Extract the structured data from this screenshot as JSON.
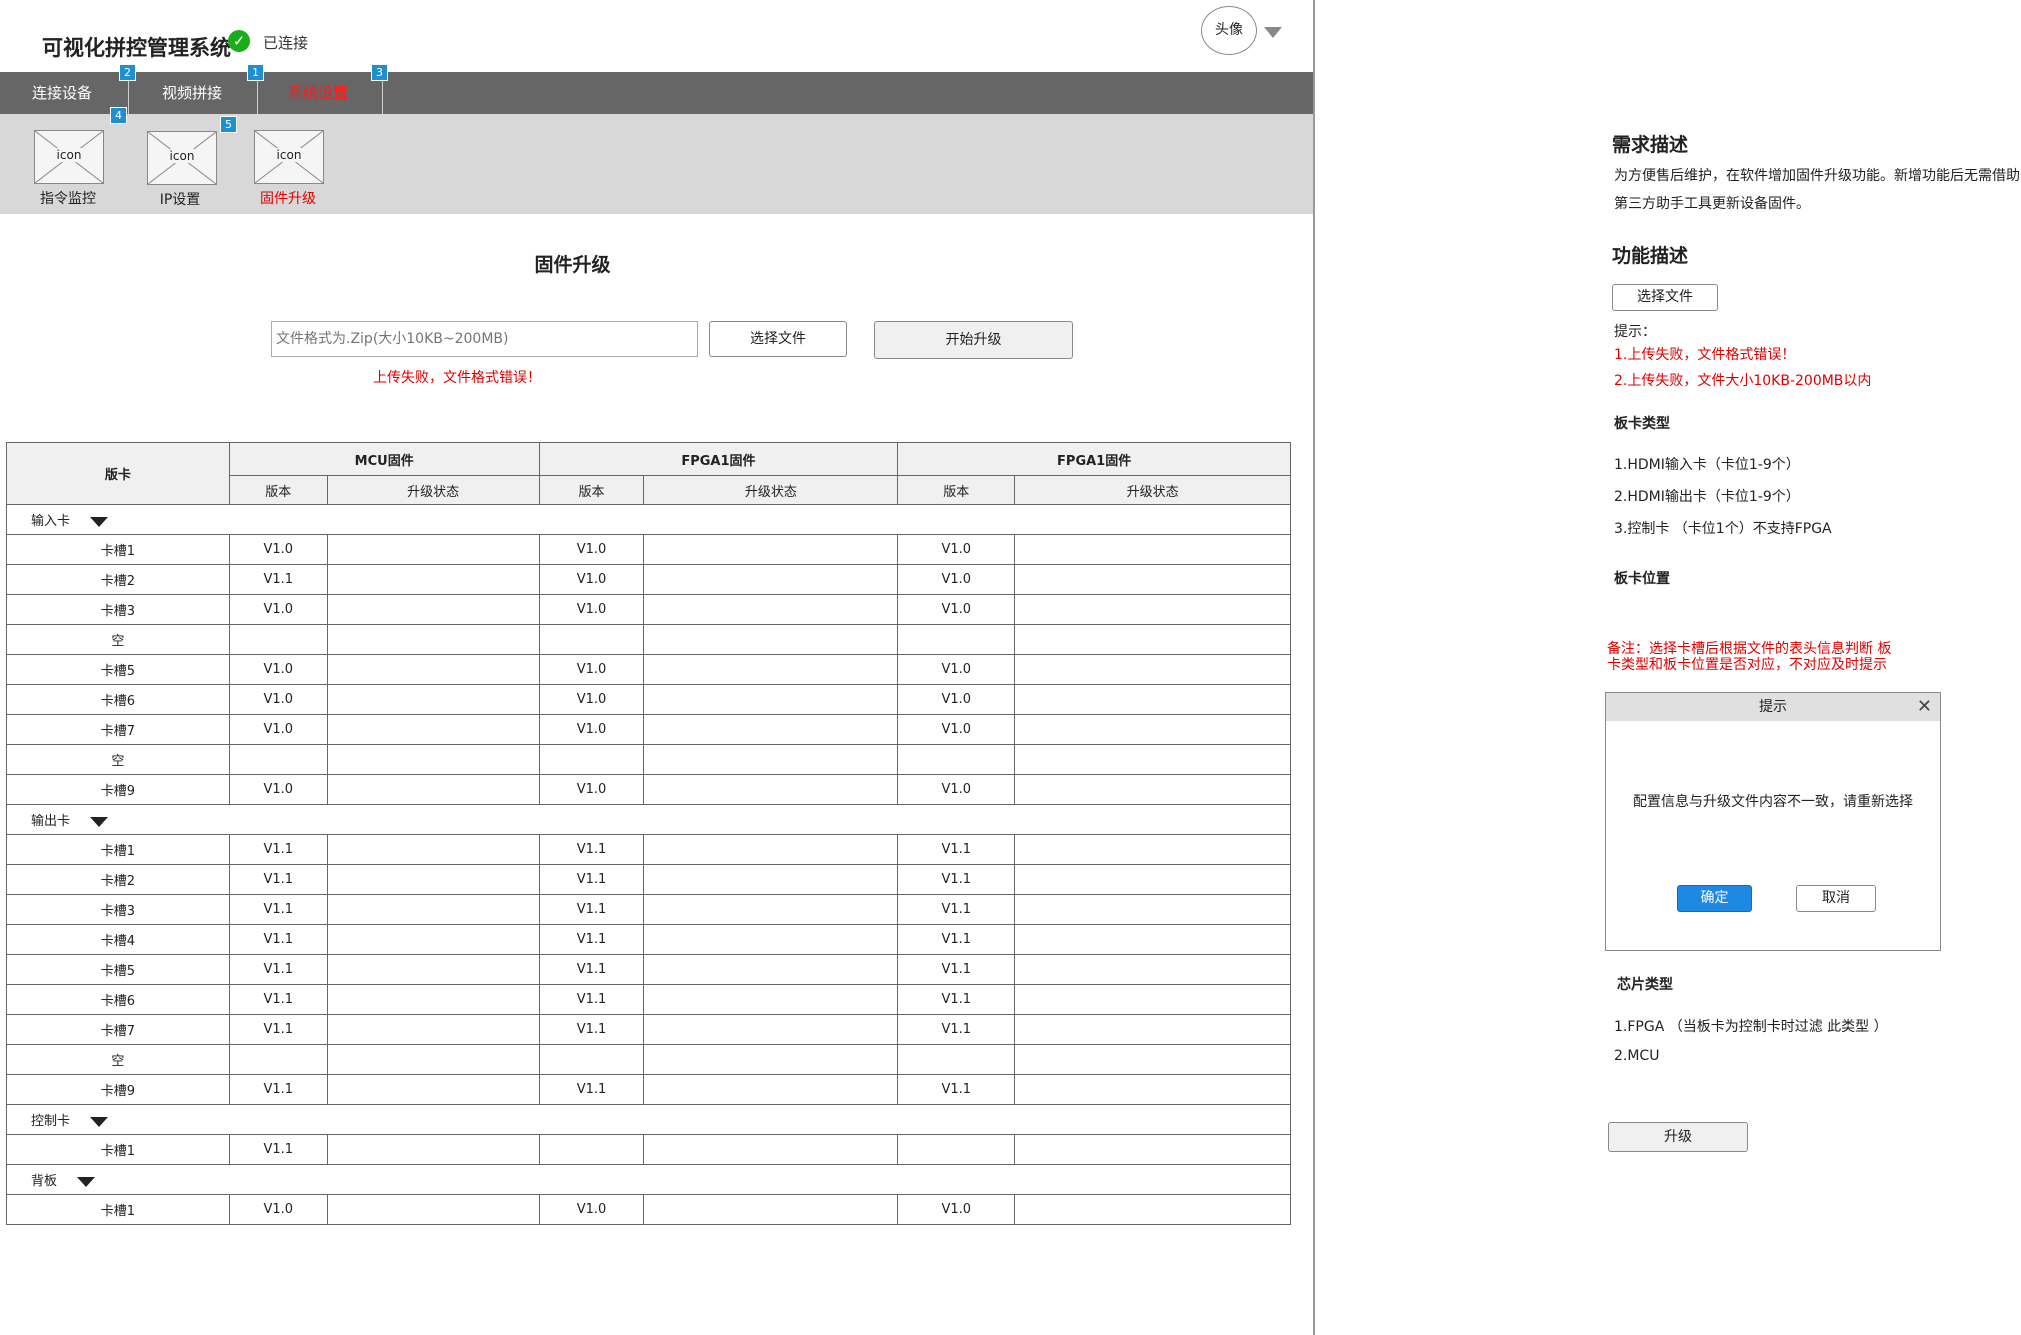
{
  "header": {
    "app_title": "可视化拼控管理系统",
    "connection_status": "已连接",
    "avatar_label": "头像",
    "status_color": "#1aad19"
  },
  "nav": {
    "tabs": [
      {
        "label": "连接设备",
        "badge": "2"
      },
      {
        "label": "视频拼接",
        "badge": "1"
      },
      {
        "label": "系统设置",
        "badge": "3",
        "active": true
      }
    ],
    "active_color": "#ff1a1a"
  },
  "subnav": {
    "items": [
      {
        "label": "指令监控",
        "icon_text": "icon",
        "badge": "4"
      },
      {
        "label": "IP设置",
        "icon_text": "icon",
        "badge": "5"
      },
      {
        "label": "固件升级",
        "icon_text": "icon",
        "active": true
      }
    ]
  },
  "main": {
    "title": "固件升级",
    "file_placeholder": "文件格式为.Zip(大小10KB~200MB)",
    "choose_file_label": "选择文件",
    "start_upgrade_label": "开始升级",
    "error_text": "上传失败，文件格式错误！"
  },
  "table": {
    "header_board": "版卡",
    "groups_header": [
      "MCU固件",
      "FPGA1固件",
      "FPGA1固件"
    ],
    "sub_version": "版本",
    "sub_status": "升级状态",
    "sections": [
      {
        "name": "输入卡",
        "rows": [
          {
            "slot": "卡槽1",
            "mcu": "V1.0",
            "fpga1": "V1.0",
            "fpga2": "V1.0"
          },
          {
            "slot": "卡槽2",
            "mcu": "V1.1",
            "fpga1": "V1.0",
            "fpga2": "V1.0"
          },
          {
            "slot": "卡槽3",
            "mcu": "V1.0",
            "fpga1": "V1.0",
            "fpga2": "V1.0"
          },
          {
            "slot": "空",
            "mcu": "",
            "fpga1": "",
            "fpga2": ""
          },
          {
            "slot": "卡槽5",
            "mcu": "V1.0",
            "fpga1": "V1.0",
            "fpga2": "V1.0"
          },
          {
            "slot": "卡槽6",
            "mcu": "V1.0",
            "fpga1": "V1.0",
            "fpga2": "V1.0"
          },
          {
            "slot": "卡槽7",
            "mcu": "V1.0",
            "fpga1": "V1.0",
            "fpga2": "V1.0"
          },
          {
            "slot": "空",
            "mcu": "",
            "fpga1": "",
            "fpga2": ""
          },
          {
            "slot": "卡槽9",
            "mcu": "V1.0",
            "fpga1": "V1.0",
            "fpga2": "V1.0"
          }
        ]
      },
      {
        "name": "输出卡",
        "rows": [
          {
            "slot": "卡槽1",
            "mcu": "V1.1",
            "fpga1": "V1.1",
            "fpga2": "V1.1"
          },
          {
            "slot": "卡槽2",
            "mcu": "V1.1",
            "fpga1": "V1.1",
            "fpga2": "V1.1"
          },
          {
            "slot": "卡槽3",
            "mcu": "V1.1",
            "fpga1": "V1.1",
            "fpga2": "V1.1"
          },
          {
            "slot": "卡槽4",
            "mcu": "V1.1",
            "fpga1": "V1.1",
            "fpga2": "V1.1"
          },
          {
            "slot": "卡槽5",
            "mcu": "V1.1",
            "fpga1": "V1.1",
            "fpga2": "V1.1"
          },
          {
            "slot": "卡槽6",
            "mcu": "V1.1",
            "fpga1": "V1.1",
            "fpga2": "V1.1"
          },
          {
            "slot": "卡槽7",
            "mcu": "V1.1",
            "fpga1": "V1.1",
            "fpga2": "V1.1"
          },
          {
            "slot": "空",
            "mcu": "",
            "fpga1": "",
            "fpga2": ""
          },
          {
            "slot": "卡槽9",
            "mcu": "V1.1",
            "fpga1": "V1.1",
            "fpga2": "V1.1"
          }
        ]
      },
      {
        "name": "控制卡",
        "rows": [
          {
            "slot": "卡槽1",
            "mcu": "V1.1",
            "fpga1": "",
            "fpga2": ""
          }
        ]
      },
      {
        "name": "背板",
        "rows": [
          {
            "slot": "卡槽1",
            "mcu": "V1.0",
            "fpga1": "V1.0",
            "fpga2": "V1.0"
          }
        ]
      }
    ]
  },
  "notes": {
    "req_title": "需求描述",
    "req_line1": "为方便售后维护，在软件增加固件升级功能。新增功能后无需借助",
    "req_line2": "第三方助手工具更新设备固件。",
    "func_title": "功能描述",
    "choose_file_label": "选择文件",
    "hint_label": "提示：",
    "hint1": "1.上传失败，文件格式错误！",
    "hint2": "2.上传失败，文件大小10KB-200MB以内",
    "board_type_title": "板卡类型",
    "board_types": [
      "1.HDMI输入卡（卡位1-9个）",
      "2.HDMI输出卡（卡位1-9个）",
      "3.控制卡 （卡位1个）不支持FPGA"
    ],
    "board_pos_title": "板卡位置",
    "remark_line1": "备注：选择卡槽后根据文件的表头信息判断 板",
    "remark_line2": "卡类型和板卡位置是否对应，不对应及时提示",
    "dialog": {
      "title": "提示",
      "close": "✕",
      "message": "配置信息与升级文件内容不一致，请重新选择",
      "ok_label": "确定",
      "cancel_label": "取消",
      "ok_color": "#1e88e5"
    },
    "chip_type_title": "芯片类型",
    "chip_types": [
      "1.FPGA （当板卡为控制卡时过滤 此类型 ）",
      "2.MCU"
    ],
    "upgrade_label": "升级"
  }
}
